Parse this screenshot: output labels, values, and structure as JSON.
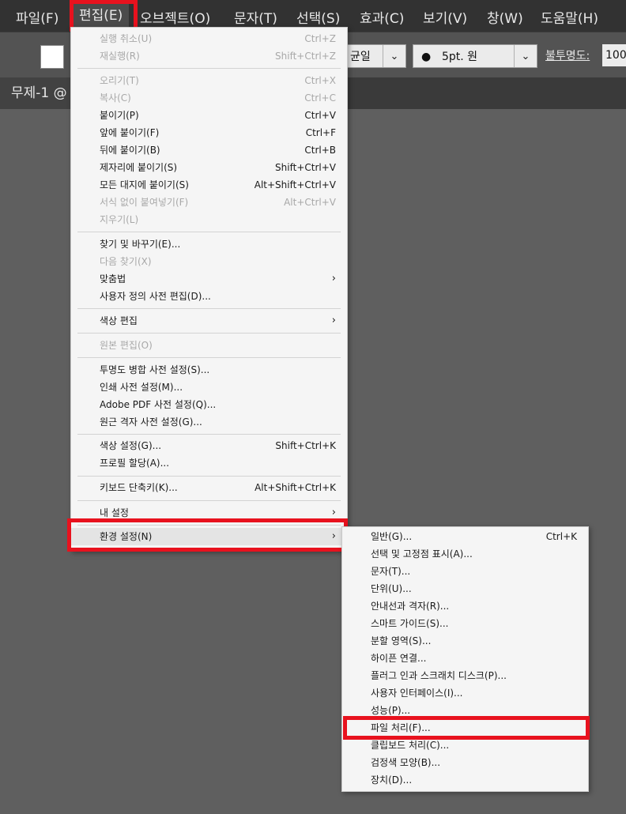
{
  "menubar": {
    "items": [
      "파일(F)",
      "편집(E)",
      "오브젝트(O)",
      "문자(T)",
      "선택(S)",
      "효과(C)",
      "보기(V)",
      "창(W)",
      "도움말(H)"
    ]
  },
  "controls": {
    "stroke_profile": "균일",
    "brush": "5pt. 원",
    "opacity_label": "불투명도:",
    "opacity_value": "100"
  },
  "document": {
    "tab_title": "무제-1 @"
  },
  "edit_menu": {
    "items": [
      {
        "label": "실행 취소(U)",
        "shortcut": "Ctrl+Z",
        "disabled": true
      },
      {
        "label": "재실행(R)",
        "shortcut": "Shift+Ctrl+Z",
        "disabled": true
      },
      {
        "label": "오리기(T)",
        "shortcut": "Ctrl+X",
        "disabled": true
      },
      {
        "label": "복사(C)",
        "shortcut": "Ctrl+C",
        "disabled": true
      },
      {
        "label": "붙이기(P)",
        "shortcut": "Ctrl+V",
        "disabled": false
      },
      {
        "label": "앞에 붙이기(F)",
        "shortcut": "Ctrl+F",
        "disabled": false
      },
      {
        "label": "뒤에 붙이기(B)",
        "shortcut": "Ctrl+B",
        "disabled": false
      },
      {
        "label": "제자리에 붙이기(S)",
        "shortcut": "Shift+Ctrl+V",
        "disabled": false
      },
      {
        "label": "모든 대지에 붙이기(S)",
        "shortcut": "Alt+Shift+Ctrl+V",
        "disabled": false
      },
      {
        "label": "서식 없이 붙여넣기(F)",
        "shortcut": "Alt+Ctrl+V",
        "disabled": true
      },
      {
        "label": "지우기(L)",
        "shortcut": "",
        "disabled": true
      },
      {
        "label": "찾기 및 바꾸기(E)...",
        "shortcut": "",
        "disabled": false
      },
      {
        "label": "다음 찾기(X)",
        "shortcut": "",
        "disabled": true
      },
      {
        "label": "맞춤법",
        "shortcut": "",
        "disabled": false,
        "submenu": true
      },
      {
        "label": "사용자 정의 사전 편집(D)...",
        "shortcut": "",
        "disabled": false
      },
      {
        "label": "색상 편집",
        "shortcut": "",
        "disabled": false,
        "submenu": true
      },
      {
        "label": "원본 편집(O)",
        "shortcut": "",
        "disabled": true
      },
      {
        "label": "투명도 병합 사전 설정(S)...",
        "shortcut": "",
        "disabled": false
      },
      {
        "label": "인쇄 사전 설정(M)...",
        "shortcut": "",
        "disabled": false
      },
      {
        "label": "Adobe PDF 사전 설정(Q)...",
        "shortcut": "",
        "disabled": false
      },
      {
        "label": "원근 격자 사전 설정(G)...",
        "shortcut": "",
        "disabled": false
      },
      {
        "label": "색상 설정(G)...",
        "shortcut": "Shift+Ctrl+K",
        "disabled": false
      },
      {
        "label": "프로필 할당(A)...",
        "shortcut": "",
        "disabled": false
      },
      {
        "label": "키보드 단축키(K)...",
        "shortcut": "Alt+Shift+Ctrl+K",
        "disabled": false
      },
      {
        "label": "내 설정",
        "shortcut": "",
        "disabled": false,
        "submenu": true
      },
      {
        "label": "환경 설정(N)",
        "shortcut": "",
        "disabled": false,
        "submenu": true
      }
    ]
  },
  "prefs_menu": {
    "items": [
      {
        "label": "일반(G)...",
        "shortcut": "Ctrl+K"
      },
      {
        "label": "선택 및 고정점 표시(A)...",
        "shortcut": ""
      },
      {
        "label": "문자(T)...",
        "shortcut": ""
      },
      {
        "label": "단위(U)...",
        "shortcut": ""
      },
      {
        "label": "안내선과 격자(R)...",
        "shortcut": ""
      },
      {
        "label": "스마트 가이드(S)...",
        "shortcut": ""
      },
      {
        "label": "분할 영역(S)...",
        "shortcut": ""
      },
      {
        "label": "하이픈 연결...",
        "shortcut": ""
      },
      {
        "label": "플러그 인과 스크래치 디스크(P)...",
        "shortcut": ""
      },
      {
        "label": "사용자 인터페이스(I)...",
        "shortcut": ""
      },
      {
        "label": "성능(P)...",
        "shortcut": ""
      },
      {
        "label": "파일 처리(F)...",
        "shortcut": ""
      },
      {
        "label": "클립보드 처리(C)...",
        "shortcut": ""
      },
      {
        "label": "검정색 모양(B)...",
        "shortcut": ""
      },
      {
        "label": "장치(D)...",
        "shortcut": ""
      }
    ]
  },
  "icons": {
    "submenu_arrow": "›",
    "dropdown_arrow": "⌄",
    "bullet": "●"
  },
  "colors": {
    "highlight": "#e8121e",
    "menu_bg": "#f5f5f5",
    "canvas": "#5f5f5f"
  }
}
